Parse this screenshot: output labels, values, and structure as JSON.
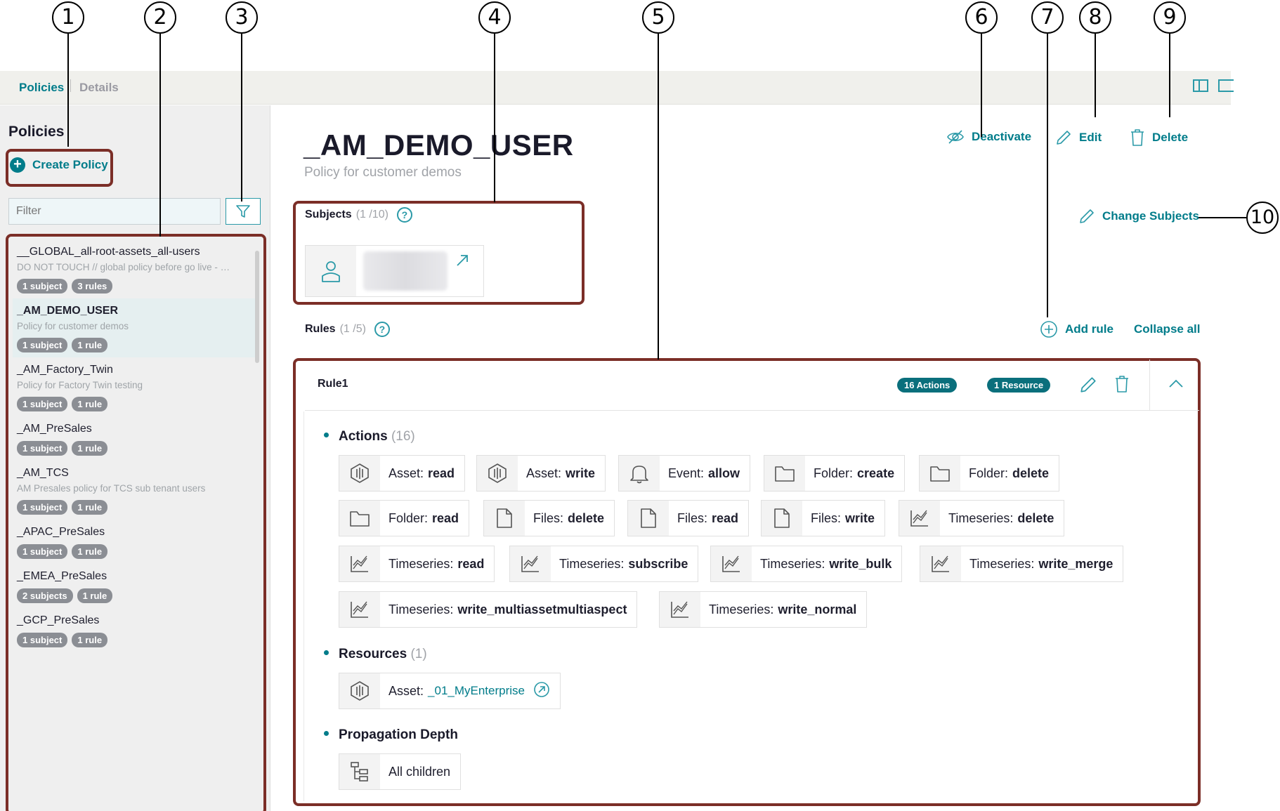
{
  "tabs": {
    "policies": "Policies",
    "details": "Details"
  },
  "sidebar": {
    "title": "Policies",
    "create_label": "Create Policy",
    "filter_placeholder": "Filter",
    "policies": [
      {
        "name": "__GLOBAL_all-root-assets_all-users",
        "desc": "DO NOT TOUCH // global policy before go live - …",
        "subjects": "1 subject",
        "rules": "3 rules"
      },
      {
        "name": "_AM_DEMO_USER",
        "desc": "Policy for customer demos",
        "subjects": "1 subject",
        "rules": "1 rule"
      },
      {
        "name": "_AM_Factory_Twin",
        "desc": "Policy for Factory Twin testing",
        "subjects": "1 subject",
        "rules": "1 rule"
      },
      {
        "name": "_AM_PreSales",
        "desc": "",
        "subjects": "1 subject",
        "rules": "1 rule"
      },
      {
        "name": "_AM_TCS",
        "desc": "AM Presales policy for TCS sub tenant users",
        "subjects": "1 subject",
        "rules": "1 rule"
      },
      {
        "name": "_APAC_PreSales",
        "desc": "",
        "subjects": "1 subject",
        "rules": "1 rule"
      },
      {
        "name": "_EMEA_PreSales",
        "desc": "",
        "subjects": "2 subjects",
        "rules": "1 rule"
      },
      {
        "name": "_GCP_PreSales",
        "desc": "",
        "subjects": "1 subject",
        "rules": "1 rule"
      }
    ]
  },
  "main": {
    "title": "_AM_DEMO_USER",
    "subtitle": "Policy for customer demos",
    "deactivate": "Deactivate",
    "edit": "Edit",
    "delete": "Delete",
    "change_subjects": "Change Subjects",
    "subjects_label": "Subjects",
    "subjects_count": "(1 /10)",
    "rules_label": "Rules",
    "rules_count": "(1 /5)",
    "add_rule": "Add rule",
    "collapse_all": "Collapse all",
    "rule": {
      "title": "Rule1",
      "actions_pill": "16 Actions",
      "resource_pill": "1 Resource",
      "actions_label": "Actions",
      "actions_count": "(16)",
      "resources_label": "Resources",
      "resources_count": "(1)",
      "propagation_label": "Propagation Depth",
      "propagation_value": "All children",
      "resource": {
        "type": "Asset:",
        "value": "_01_MyEnterprise"
      },
      "actions": [
        {
          "type": "Asset:",
          "perm": "read",
          "icon": "asset-icon"
        },
        {
          "type": "Asset:",
          "perm": "write",
          "icon": "asset-icon"
        },
        {
          "type": "Event:",
          "perm": "allow",
          "icon": "bell-icon"
        },
        {
          "type": "Folder:",
          "perm": "create",
          "icon": "folder-icon"
        },
        {
          "type": "Folder:",
          "perm": "delete",
          "icon": "folder-icon"
        },
        {
          "type": "Folder:",
          "perm": "read",
          "icon": "folder-icon"
        },
        {
          "type": "Files:",
          "perm": "delete",
          "icon": "file-icon"
        },
        {
          "type": "Files:",
          "perm": "read",
          "icon": "file-icon"
        },
        {
          "type": "Files:",
          "perm": "write",
          "icon": "file-icon"
        },
        {
          "type": "Timeseries:",
          "perm": "delete",
          "icon": "timeseries-icon"
        },
        {
          "type": "Timeseries:",
          "perm": "read",
          "icon": "timeseries-icon"
        },
        {
          "type": "Timeseries:",
          "perm": "subscribe",
          "icon": "timeseries-icon"
        },
        {
          "type": "Timeseries:",
          "perm": "write_bulk",
          "icon": "timeseries-icon"
        },
        {
          "type": "Timeseries:",
          "perm": "write_merge",
          "icon": "timeseries-icon"
        },
        {
          "type": "Timeseries:",
          "perm": "write_multiassetmultiaspect",
          "icon": "timeseries-icon"
        },
        {
          "type": "Timeseries:",
          "perm": "write_normal",
          "icon": "timeseries-icon"
        }
      ]
    }
  },
  "callouts": [
    "1",
    "2",
    "3",
    "4",
    "5",
    "6",
    "7",
    "8",
    "9",
    "10"
  ],
  "colors": {
    "accent": "#007c8a",
    "highlight_border": "#7b2e27",
    "badge": "#8b8e94"
  }
}
